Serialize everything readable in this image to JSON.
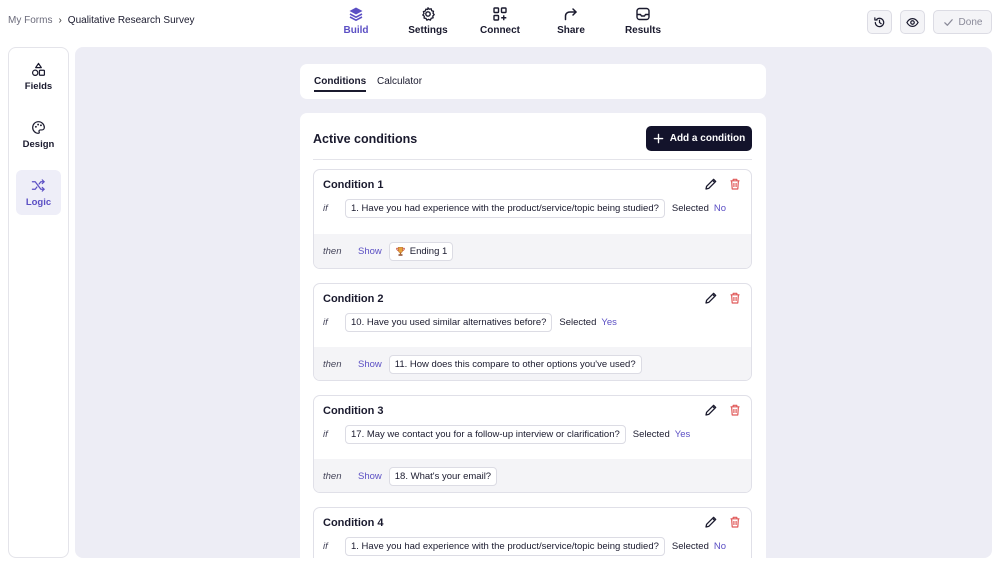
{
  "breadcrumb": {
    "root": "My Forms",
    "separator": "›",
    "current": "Qualitative Research Survey"
  },
  "nav": [
    {
      "label": "Build",
      "icon": "layers-icon",
      "active": true
    },
    {
      "label": "Settings",
      "icon": "gear-icon",
      "active": false
    },
    {
      "label": "Connect",
      "icon": "grid-plus-icon",
      "active": false
    },
    {
      "label": "Share",
      "icon": "share-arrow-icon",
      "active": false
    },
    {
      "label": "Results",
      "icon": "inbox-icon",
      "active": false
    }
  ],
  "top_actions": {
    "history_icon": "history-icon",
    "preview_icon": "eye-icon",
    "done_label": "Done"
  },
  "sidebar": [
    {
      "label": "Fields",
      "icon": "shapes-icon",
      "active": false
    },
    {
      "label": "Design",
      "icon": "palette-icon",
      "active": false
    },
    {
      "label": "Logic",
      "icon": "shuffle-icon",
      "active": true
    }
  ],
  "tabs": [
    {
      "label": "Conditions",
      "active": true
    },
    {
      "label": "Calculator",
      "active": false
    }
  ],
  "conditions_panel": {
    "title": "Active conditions",
    "add_label": "Add a condition"
  },
  "keywords": {
    "if": "if",
    "then": "then"
  },
  "conditions": [
    {
      "name": "Condition 1",
      "question": "1. Have you had experience with the product/service/topic being studied?",
      "operator": "Selected",
      "value": "No",
      "action": "Show",
      "target": "Ending 1",
      "target_icon": "trophy-icon"
    },
    {
      "name": "Condition 2",
      "question": "10. Have you used similar alternatives before?",
      "operator": "Selected",
      "value": "Yes",
      "action": "Show",
      "target": "11. How does this compare to other options you've used?"
    },
    {
      "name": "Condition 3",
      "question": "17. May we contact you for a follow-up interview or clarification?",
      "operator": "Selected",
      "value": "Yes",
      "action": "Show",
      "target": "18. What's your email?"
    },
    {
      "name": "Condition 4",
      "question": "1. Have you had experience with the product/service/topic being studied?",
      "operator": "Selected",
      "value": "No"
    }
  ],
  "colors": {
    "accent": "#5b4fc4",
    "dark": "#13132b",
    "danger": "#e05a5a",
    "panel_bg": "#ededf5"
  }
}
